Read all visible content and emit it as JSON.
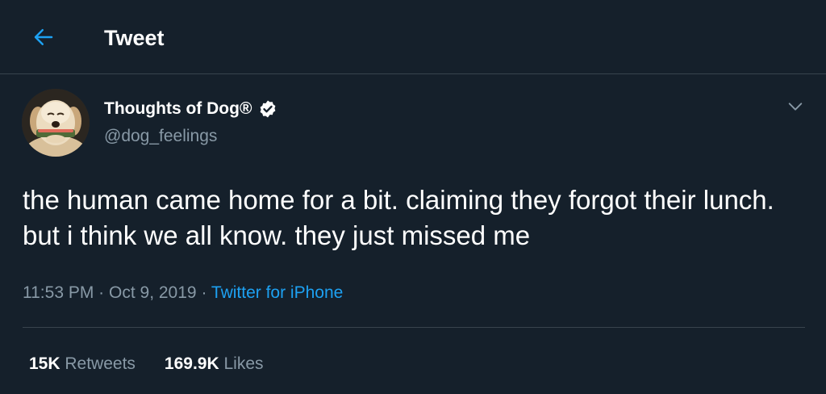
{
  "header": {
    "title": "Tweet",
    "back_icon": "arrow-left-icon"
  },
  "author": {
    "display_name": "Thoughts of Dog®",
    "username": "@dog_feelings",
    "verified": true,
    "avatar": "dog-avatar"
  },
  "tweet": {
    "text": "the human came home for a bit. claiming they forgot their lunch. but i think we all know. they just missed me",
    "time": "11:53 PM",
    "date": "Oct 9, 2019",
    "separator": "·",
    "source": "Twitter for iPhone"
  },
  "stats": {
    "retweets_count": "15K",
    "retweets_label": "Retweets",
    "likes_count": "169.9K",
    "likes_label": "Likes"
  },
  "colors": {
    "background": "#15202b",
    "accent": "#1da1f2",
    "muted": "#8899a6",
    "border": "#38444d"
  }
}
